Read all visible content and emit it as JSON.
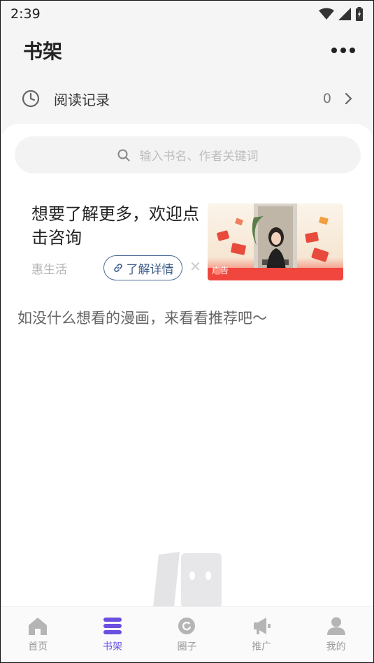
{
  "status_bar": {
    "time": "2:39",
    "icons": [
      "wifi-icon",
      "signal-icon",
      "battery-icon"
    ]
  },
  "header": {
    "title": "书架",
    "more_icon": "more-icon"
  },
  "reading_history": {
    "icon": "clock-icon",
    "label": "阅读记录",
    "count": "0"
  },
  "search": {
    "icon": "search-icon",
    "placeholder": "输入书名、作者关键词"
  },
  "ad": {
    "title": "想要了解更多，欢迎点击咨询",
    "source": "惠生活",
    "link_label": "了解详情",
    "close_label": "✕",
    "badge_label": "广告"
  },
  "empty_state": {
    "recommend_text": "如没什么想看的漫画，来看看推荐吧～"
  },
  "tab_bar": {
    "items": [
      {
        "label": "首页",
        "icon": "home-icon"
      },
      {
        "label": "书架",
        "icon": "bookshelf-icon"
      },
      {
        "label": "圈子",
        "icon": "circle-icon"
      },
      {
        "label": "推广",
        "icon": "megaphone-icon"
      },
      {
        "label": "我的",
        "icon": "profile-icon"
      }
    ],
    "active_index": 1
  },
  "colors": {
    "accent": "#6b4fe0",
    "link_border": "#4a6a96",
    "inactive_icon": "#b5b5b5"
  }
}
